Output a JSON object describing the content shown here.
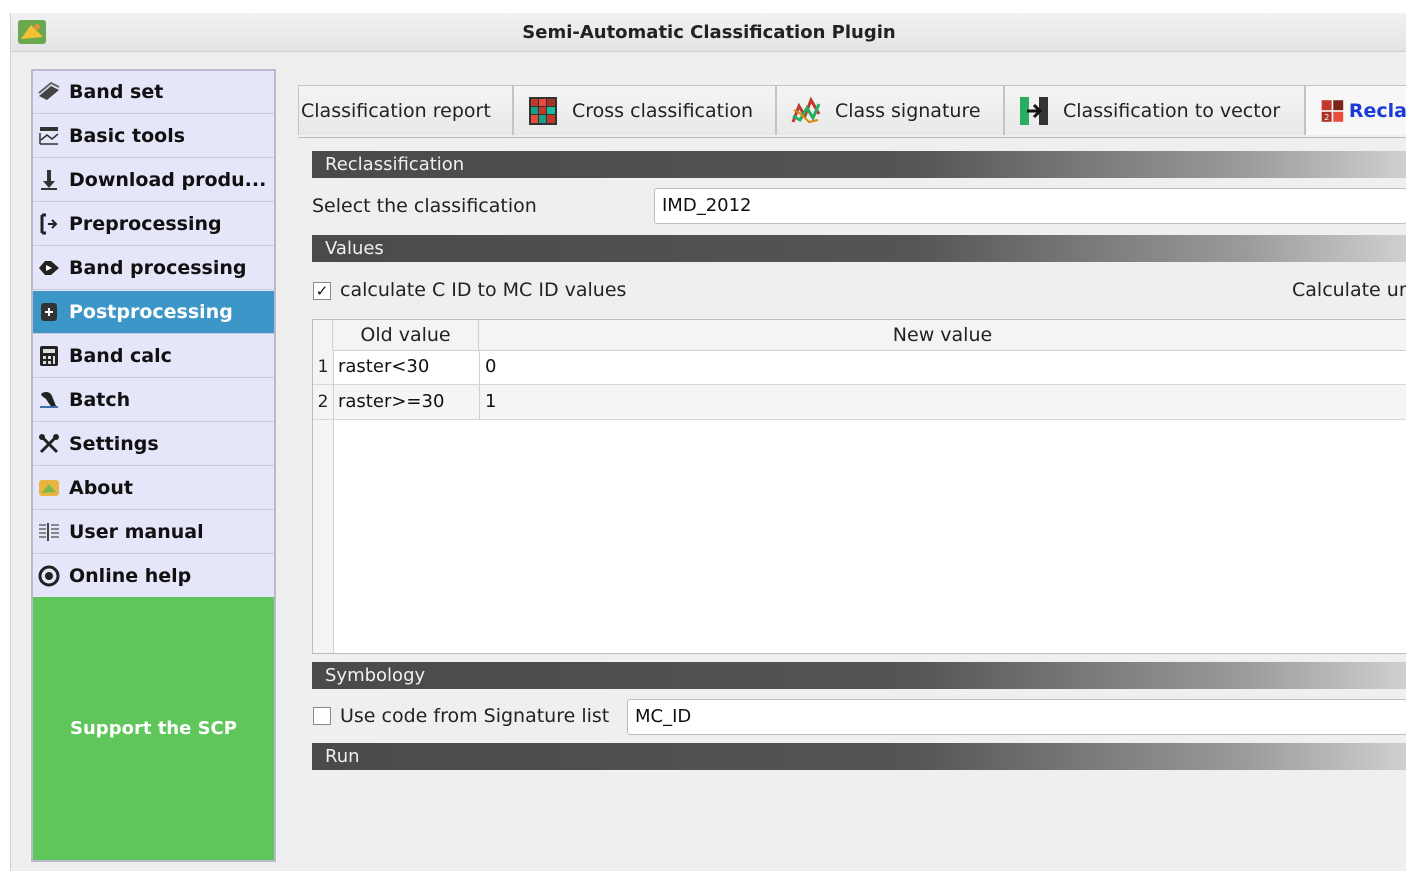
{
  "window": {
    "title": "Semi-Automatic Classification Plugin"
  },
  "sidebar": {
    "items": [
      {
        "label": "Band set",
        "icon": "band-set-icon"
      },
      {
        "label": "Basic tools",
        "icon": "basic-tools-icon"
      },
      {
        "label": "Download produ...",
        "icon": "download-icon"
      },
      {
        "label": "Preprocessing",
        "icon": "preprocessing-icon"
      },
      {
        "label": "Band processing",
        "icon": "band-processing-icon"
      },
      {
        "label": "Postprocessing",
        "icon": "postprocessing-icon",
        "active": true
      },
      {
        "label": "Band calc",
        "icon": "calculator-icon"
      },
      {
        "label": "Batch",
        "icon": "batch-icon"
      },
      {
        "label": "Settings",
        "icon": "settings-icon"
      },
      {
        "label": "About",
        "icon": "about-icon"
      },
      {
        "label": "User manual",
        "icon": "manual-icon"
      },
      {
        "label": "Online help",
        "icon": "help-icon"
      }
    ],
    "support_label": "Support the SCP"
  },
  "tabs": [
    {
      "label": "Classification report",
      "icon": ""
    },
    {
      "label": "Cross classification",
      "icon": "cross-classification-icon"
    },
    {
      "label": "Class signature",
      "icon": "class-signature-icon"
    },
    {
      "label": "Classification to vector",
      "icon": "classification-to-vector-icon"
    },
    {
      "label": "Recla",
      "icon": "reclassification-icon",
      "active": true
    }
  ],
  "reclassification": {
    "section_title": "Reclassification",
    "select_label": "Select the classification",
    "select_value": "IMD_2012"
  },
  "values": {
    "section_title": "Values",
    "calc_checkbox_label": "calculate C ID to MC ID values",
    "calc_checked": true,
    "calc_unique_label": "Calculate ur",
    "table": {
      "headers": [
        "Old value",
        "New value"
      ],
      "rows": [
        {
          "num": "1",
          "old": "raster<30",
          "new": "0"
        },
        {
          "num": "2",
          "old": "raster>=30",
          "new": "1"
        }
      ]
    }
  },
  "symbology": {
    "section_title": "Symbology",
    "use_code_label": "Use code from Signature list",
    "use_code_checked": false,
    "code_value": "MC_ID"
  },
  "run": {
    "section_title": "Run"
  },
  "colors": {
    "active_nav": "#3c96c8",
    "support_bg": "#5ec65a",
    "active_tab_text": "#1a3bd8"
  }
}
